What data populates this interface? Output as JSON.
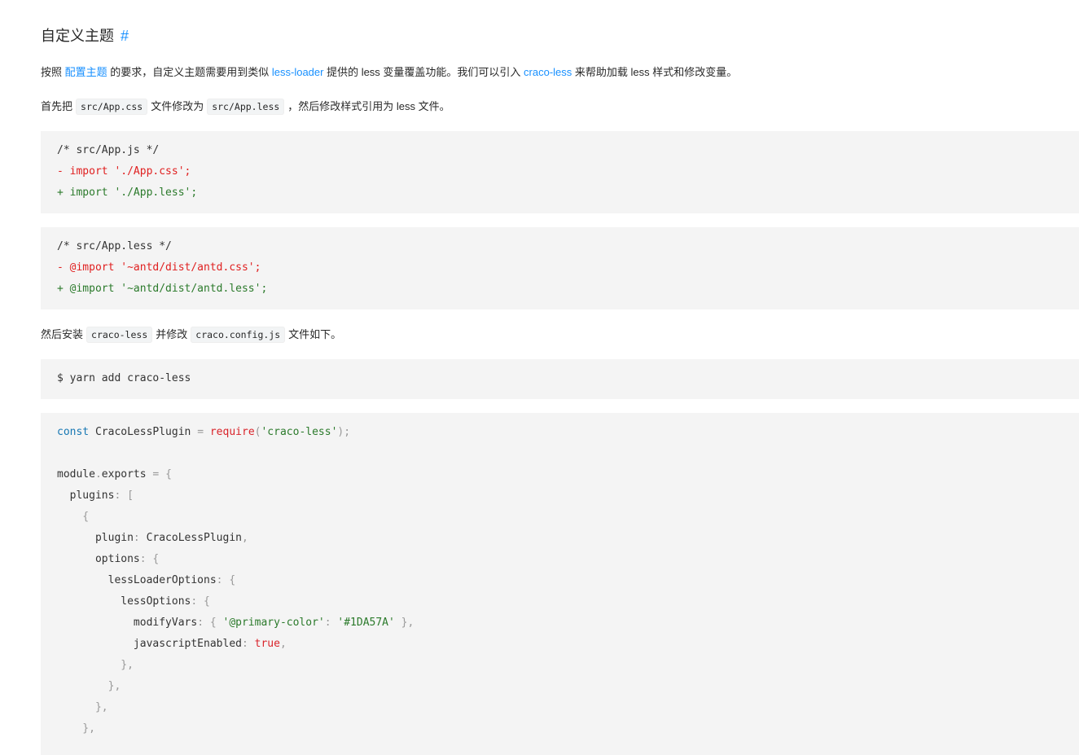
{
  "heading": {
    "title": "自定义主题",
    "anchor": "#"
  },
  "para1": {
    "t1": "按照 ",
    "link1": "配置主题",
    "t2": " 的要求，自定义主题需要用到类似 ",
    "link2": "less-loader",
    "t3": " 提供的 less 变量覆盖功能。我们可以引入 ",
    "link3": "craco-less",
    "t4": " 来帮助加载 less 样式和修改变量。"
  },
  "para2": {
    "t1": "首先把",
    "code1": "src/App.css",
    "t2": "文件修改为",
    "code2": "src/App.less",
    "t3": "，然后修改样式引用为 less 文件。"
  },
  "block1": {
    "comment": "/* src/App.js */",
    "del": "- import './App.css';",
    "add": "+ import './App.less';"
  },
  "block2": {
    "comment": "/* src/App.less */",
    "del": "- @import '~antd/dist/antd.css';",
    "add": "+ @import '~antd/dist/antd.less';"
  },
  "para3": {
    "t1": "然后安装",
    "code1": "craco-less",
    "t2": "并修改",
    "code2": "craco.config.js",
    "t3": "文件如下。"
  },
  "block3": {
    "cmd": "$ yarn add craco-less"
  },
  "block4": {
    "l1_kw": "const",
    "l1_name": " CracoLessPlugin ",
    "l1_eq": "=",
    "l1_req": " require",
    "l1_p1": "(",
    "l1_str": "'craco-less'",
    "l1_p2": ");",
    "l3_a": "module",
    "l3_dot": ".",
    "l3_b": "exports ",
    "l3_eq": "=",
    "l3_br": " {",
    "l4_key": "  plugins",
    "l4_p": ": [",
    "l5": "    {",
    "l6_key": "      plugin",
    "l6_p1": ": ",
    "l6_val": "CracoLessPlugin",
    "l6_p2": ",",
    "l7_key": "      options",
    "l7_p": ": {",
    "l8_key": "        lessLoaderOptions",
    "l8_p": ": {",
    "l9_key": "          lessOptions",
    "l9_p": ": {",
    "l10_key": "            modifyVars",
    "l10_p1": ": { ",
    "l10_s1": "'@primary-color'",
    "l10_p2": ": ",
    "l10_s2": "'#1DA57A'",
    "l10_p3": " },",
    "l11_key": "            javascriptEnabled",
    "l11_p1": ": ",
    "l11_val": "true",
    "l11_p2": ",",
    "l12": "          },",
    "l13": "        },",
    "l14": "      },",
    "l15": "    },"
  }
}
